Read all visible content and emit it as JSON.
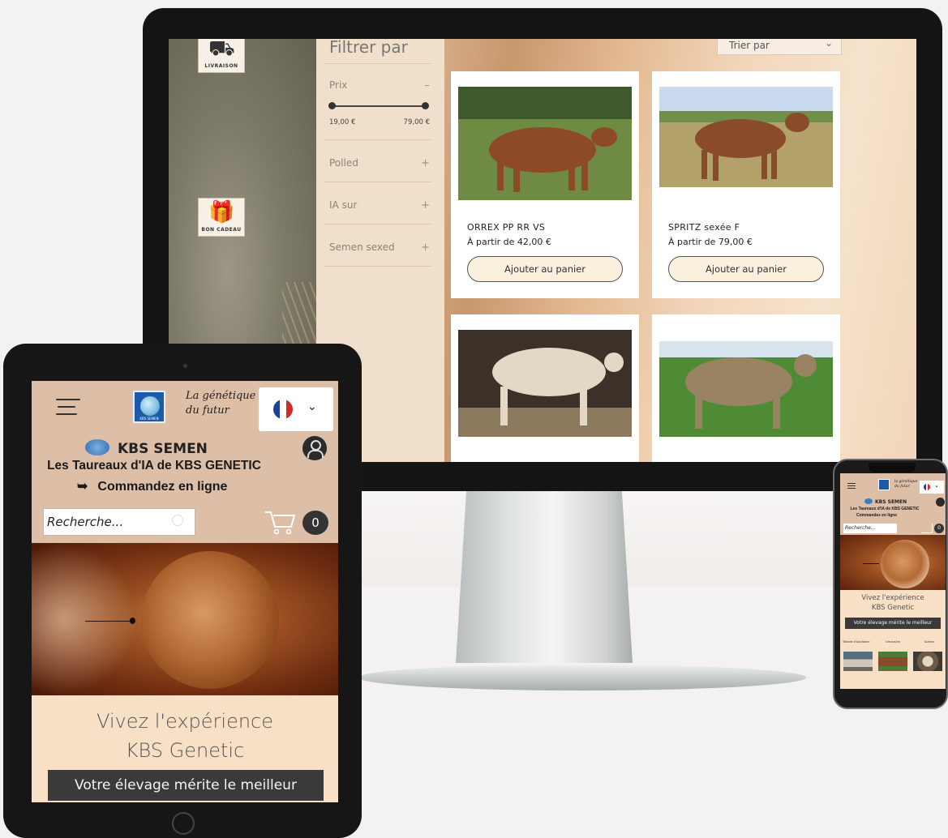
{
  "desktop": {
    "filter": {
      "title": "Filtrer par",
      "price_label": "Prix",
      "price_toggle": "–",
      "price_min": "19,00 €",
      "price_max": "79,00 €",
      "groups": [
        {
          "label": "Polled",
          "toggle": "+"
        },
        {
          "label": "IA sur",
          "toggle": "+"
        },
        {
          "label": "Semen sexed",
          "toggle": "+"
        }
      ]
    },
    "sort": {
      "label": "Trier par"
    },
    "side_icons": [
      {
        "icon": "delivery-truck-icon",
        "caption": "LIVRAISON"
      },
      {
        "icon": "gift-box-icon",
        "caption": "BON CADEAU"
      }
    ],
    "products": [
      {
        "name": "ORREX PP RR VS",
        "price": "À partir de 42,00 €",
        "button": "Ajouter au panier",
        "photo_bg": "#6f8a43",
        "animal": "#8e4a26"
      },
      {
        "name": "SPRITZ sexée F",
        "price": "À partir de 79,00 €",
        "button": "Ajouter au panier",
        "photo_bg": "#b2a169",
        "animal": "#8a4b2b"
      },
      {
        "name": "",
        "price": "",
        "button": "",
        "photo_bg": "#3b3128",
        "animal": "#e3d7c6"
      },
      {
        "name": "",
        "price": "",
        "button": "",
        "photo_bg": "#4f8a35",
        "animal": "#9a8363"
      }
    ]
  },
  "tablet": {
    "tagline": [
      "La génétique",
      "du futur"
    ],
    "logo_text": "KBS SEMEN",
    "brand": "KBS SEMEN",
    "subtitle": "Les Taureaux d'IA de KBS GENETIC",
    "order_arrow": "➥",
    "order": "Commandez en ligne",
    "search_placeholder": "Recherche...",
    "cart_count": "0",
    "hero_title_1": "Vivez l'expérience",
    "hero_title_2": "KBS Genetic",
    "cta": "Votre élevage mérite le meilleur",
    "flag_colors": [
      "#1f3f9a",
      "#ffffff",
      "#d32a2a"
    ]
  },
  "phone": {
    "tagline": [
      "la génétique",
      "du futur"
    ],
    "brand": "KBS SEMEN",
    "subtitle": "Les Taureaux d'IA de KBS GENETIC",
    "order": "Commandez en ligne",
    "search_placeholder": "Recherche...",
    "cart_count": "0",
    "hero_title_1": "Vivez l'expérience",
    "hero_title_2": "KBS Genetic",
    "cta": "Votre élevage mérite le meilleur",
    "categories": [
      "Blonde d'Aquitaine",
      "Limousine",
      "Aubrac"
    ]
  }
}
